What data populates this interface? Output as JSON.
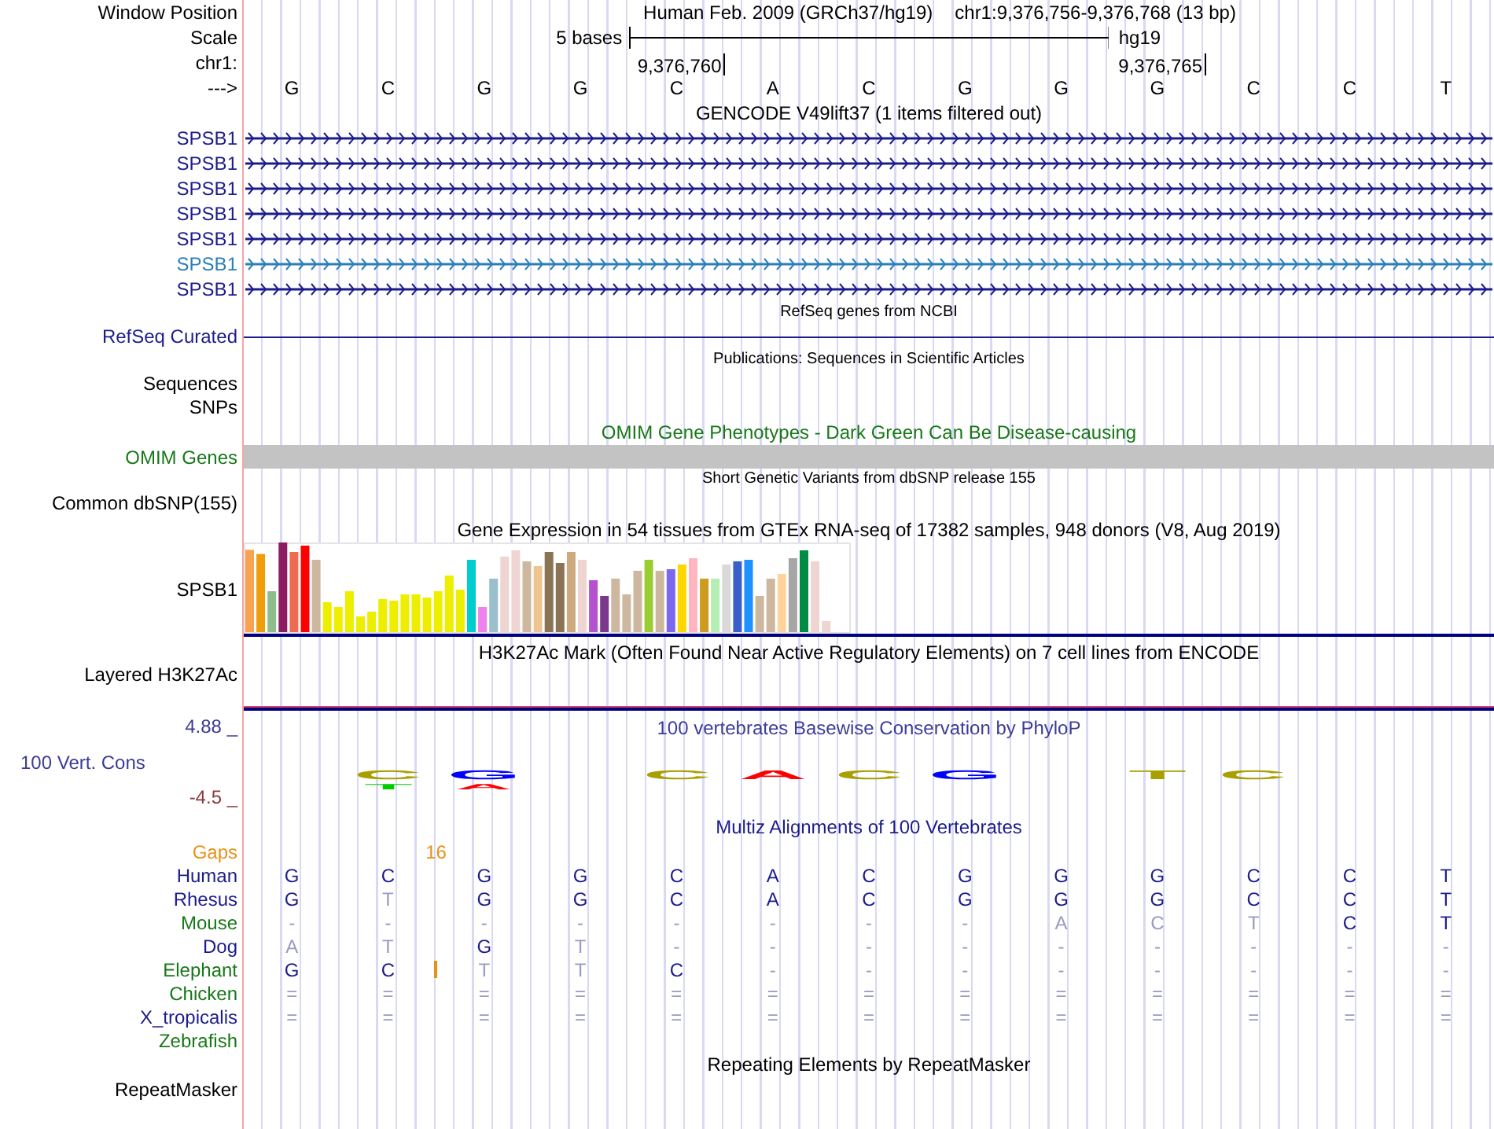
{
  "header": {
    "position_label": "Window Position",
    "genome": "Human Feb. 2009 (GRCh37/hg19)",
    "range": "chr1:9,376,756-9,376,768 (13 bp)",
    "scale_label": "Scale",
    "scale_text": "5 bases",
    "assembly": "hg19",
    "chrom_label": "chr1:",
    "ticks": [
      "9,376,760",
      "9,376,765"
    ],
    "strand_label": "--->",
    "bases": [
      "G",
      "C",
      "G",
      "G",
      "C",
      "A",
      "C",
      "G",
      "G",
      "G",
      "C",
      "C",
      "T"
    ]
  },
  "tracks": [
    {
      "kind": "genes",
      "title": "GENCODE V49lift37 (1 items filtered out)",
      "color": "#000000",
      "items": [
        {
          "label": "SPSB1",
          "color": "#1c1c8c"
        },
        {
          "label": "SPSB1",
          "color": "#1c1c8c"
        },
        {
          "label": "SPSB1",
          "color": "#1c1c8c"
        },
        {
          "label": "SPSB1",
          "color": "#1c1c8c"
        },
        {
          "label": "SPSB1",
          "color": "#1c1c8c"
        },
        {
          "label": "SPSB1",
          "color": "#2a7fb8"
        },
        {
          "label": "SPSB1",
          "color": "#1c1c8c"
        }
      ]
    },
    {
      "kind": "line",
      "title": "RefSeq genes from NCBI",
      "color": "#000000",
      "label": "RefSeq Curated"
    },
    {
      "kind": "labels",
      "title": "Publications: Sequences in Scientific Articles",
      "color": "#000000",
      "labels": [
        "Sequences",
        "SNPs"
      ]
    },
    {
      "kind": "bar",
      "title": "OMIM Gene Phenotypes - Dark Green Can Be Disease-causing",
      "color": "#187818",
      "label": "OMIM Genes"
    },
    {
      "kind": "labels",
      "title": "Short Genetic Variants from dbSNP release 155",
      "color": "#000000",
      "labels": [
        "Common dbSNP(155)"
      ]
    },
    {
      "kind": "expression",
      "title": "Gene Expression in 54 tissues from GTEx RNA-seq of 17382 samples, 948 donors (V8, Aug 2019)",
      "color": "#000000",
      "label": "SPSB1"
    },
    {
      "kind": "layered",
      "title": "H3K27Ac Mark (Often Found Near Active Regulatory Elements) on 7 cell lines from ENCODE",
      "color": "#000000",
      "label": "Layered H3K27Ac"
    },
    {
      "kind": "conservation",
      "title": "100 vertebrates Basewise Conservation by PhyloP",
      "color": "#3c3c96",
      "label": "100 Vert. Cons",
      "max": "4.88 _",
      "min": "-4.5 _",
      "logos": [
        {
          "kind": "blank"
        },
        {
          "kind": "logo",
          "letters": [
            {
              "letter": "C",
              "color": "#a8a000"
            },
            {
              "letter": "T",
              "color": "#00cc00"
            }
          ]
        },
        {
          "kind": "logo",
          "letters": [
            {
              "letter": "G",
              "color": "#0000ff"
            },
            {
              "letter": "A",
              "color": "#ff0000"
            }
          ]
        },
        {
          "kind": "blank"
        },
        {
          "kind": "logo",
          "letters": [
            {
              "letter": "C",
              "color": "#a8a000"
            }
          ]
        },
        {
          "kind": "logo",
          "letters": [
            {
              "letter": "A",
              "color": "#ff0000"
            }
          ]
        },
        {
          "kind": "logo",
          "letters": [
            {
              "letter": "C",
              "color": "#a8a000"
            }
          ]
        },
        {
          "kind": "logo",
          "letters": [
            {
              "letter": "G",
              "color": "#0000ff"
            }
          ]
        },
        {
          "kind": "blank"
        },
        {
          "kind": "logo",
          "letters": [
            {
              "letter": "T",
              "color": "#a8a000"
            }
          ]
        },
        {
          "kind": "logo",
          "letters": [
            {
              "letter": "C",
              "color": "#a8a000"
            }
          ]
        },
        {
          "kind": "blank"
        },
        {
          "kind": "blank"
        }
      ]
    },
    {
      "kind": "alignment",
      "title": "Multiz Alignments of 100 Vertebrates",
      "color": "#1c1c8c",
      "gaps_label": "Gaps",
      "gap_marks": [
        "16"
      ],
      "species": [
        {
          "label": "Human",
          "color": "#1c1c8c",
          "bases": [
            {
              "b": "G",
              "match": true
            },
            {
              "b": "C",
              "match": true
            },
            {
              "b": "G",
              "match": true
            },
            {
              "b": "G",
              "match": true
            },
            {
              "b": "C",
              "match": true
            },
            {
              "b": "A",
              "match": true
            },
            {
              "b": "C",
              "match": true
            },
            {
              "b": "G",
              "match": true
            },
            {
              "b": "G",
              "match": true
            },
            {
              "b": "G",
              "match": true
            },
            {
              "b": "C",
              "match": true
            },
            {
              "b": "C",
              "match": true
            },
            {
              "b": "T",
              "match": true
            }
          ]
        },
        {
          "label": "Rhesus",
          "color": "#1c1c8c",
          "bases": [
            {
              "b": "G",
              "match": true
            },
            {
              "b": "T",
              "match": false
            },
            {
              "b": "G",
              "match": true
            },
            {
              "b": "G",
              "match": true
            },
            {
              "b": "C",
              "match": true
            },
            {
              "b": "A",
              "match": true
            },
            {
              "b": "C",
              "match": true
            },
            {
              "b": "G",
              "match": true
            },
            {
              "b": "G",
              "match": true
            },
            {
              "b": "G",
              "match": true
            },
            {
              "b": "C",
              "match": true
            },
            {
              "b": "C",
              "match": true
            },
            {
              "b": "T",
              "match": true
            }
          ]
        },
        {
          "label": "Mouse",
          "color": "#187818",
          "bases": [
            {
              "b": "-",
              "match": false
            },
            {
              "b": "-",
              "match": false
            },
            {
              "b": "-",
              "match": false
            },
            {
              "b": "-",
              "match": false
            },
            {
              "b": "-",
              "match": false
            },
            {
              "b": "-",
              "match": false
            },
            {
              "b": "-",
              "match": false
            },
            {
              "b": "-",
              "match": false
            },
            {
              "b": "A",
              "match": false
            },
            {
              "b": "C",
              "match": false
            },
            {
              "b": "T",
              "match": false
            },
            {
              "b": "C",
              "match": true
            },
            {
              "b": "T",
              "match": true
            }
          ]
        },
        {
          "label": "Dog",
          "color": "#1c1c8c",
          "bases": [
            {
              "b": "A",
              "match": false
            },
            {
              "b": "T",
              "match": false
            },
            {
              "b": "G",
              "match": true
            },
            {
              "b": "T",
              "match": false
            },
            {
              "b": "-",
              "match": false
            },
            {
              "b": "-",
              "match": false
            },
            {
              "b": "-",
              "match": false
            },
            {
              "b": "-",
              "match": false
            },
            {
              "b": "-",
              "match": false
            },
            {
              "b": "-",
              "match": false
            },
            {
              "b": "-",
              "match": false
            },
            {
              "b": "-",
              "match": false
            },
            {
              "b": "-",
              "match": false
            }
          ]
        },
        {
          "label": "Elephant",
          "color": "#187818",
          "bases": [
            {
              "b": "G",
              "match": true
            },
            {
              "b": "C",
              "match": true,
              "insertion": true
            },
            {
              "b": "T",
              "match": false
            },
            {
              "b": "T",
              "match": false
            },
            {
              "b": "C",
              "match": true
            },
            {
              "b": "-",
              "match": false
            },
            {
              "b": "-",
              "match": false
            },
            {
              "b": "-",
              "match": false
            },
            {
              "b": "-",
              "match": false
            },
            {
              "b": "-",
              "match": false
            },
            {
              "b": "-",
              "match": false
            },
            {
              "b": "-",
              "match": false
            },
            {
              "b": "-",
              "match": false
            }
          ]
        },
        {
          "label": "Chicken",
          "color": "#187818",
          "bases": [
            {
              "b": "=",
              "match": false
            },
            {
              "b": "=",
              "match": false
            },
            {
              "b": "=",
              "match": false
            },
            {
              "b": "=",
              "match": false
            },
            {
              "b": "=",
              "match": false
            },
            {
              "b": "=",
              "match": false
            },
            {
              "b": "=",
              "match": false
            },
            {
              "b": "=",
              "match": false
            },
            {
              "b": "=",
              "match": false
            },
            {
              "b": "=",
              "match": false
            },
            {
              "b": "=",
              "match": false
            },
            {
              "b": "=",
              "match": false
            },
            {
              "b": "=",
              "match": false
            }
          ]
        },
        {
          "label": "X_tropicalis",
          "color": "#1c1c8c",
          "bases": [
            {
              "b": "=",
              "match": false
            },
            {
              "b": "=",
              "match": false
            },
            {
              "b": "=",
              "match": false
            },
            {
              "b": "=",
              "match": false
            },
            {
              "b": "=",
              "match": false
            },
            {
              "b": "=",
              "match": false
            },
            {
              "b": "=",
              "match": false
            },
            {
              "b": "=",
              "match": false
            },
            {
              "b": "=",
              "match": false
            },
            {
              "b": "=",
              "match": false
            },
            {
              "b": "=",
              "match": false
            },
            {
              "b": "=",
              "match": false
            },
            {
              "b": "=",
              "match": false
            }
          ]
        },
        {
          "label": "Zebrafish",
          "color": "#187818"
        }
      ]
    },
    {
      "kind": "repeats",
      "title": "Repeating Elements by RepeatMasker",
      "color": "#000000",
      "labels": [
        "RepeatMasker"
      ]
    }
  ]
}
